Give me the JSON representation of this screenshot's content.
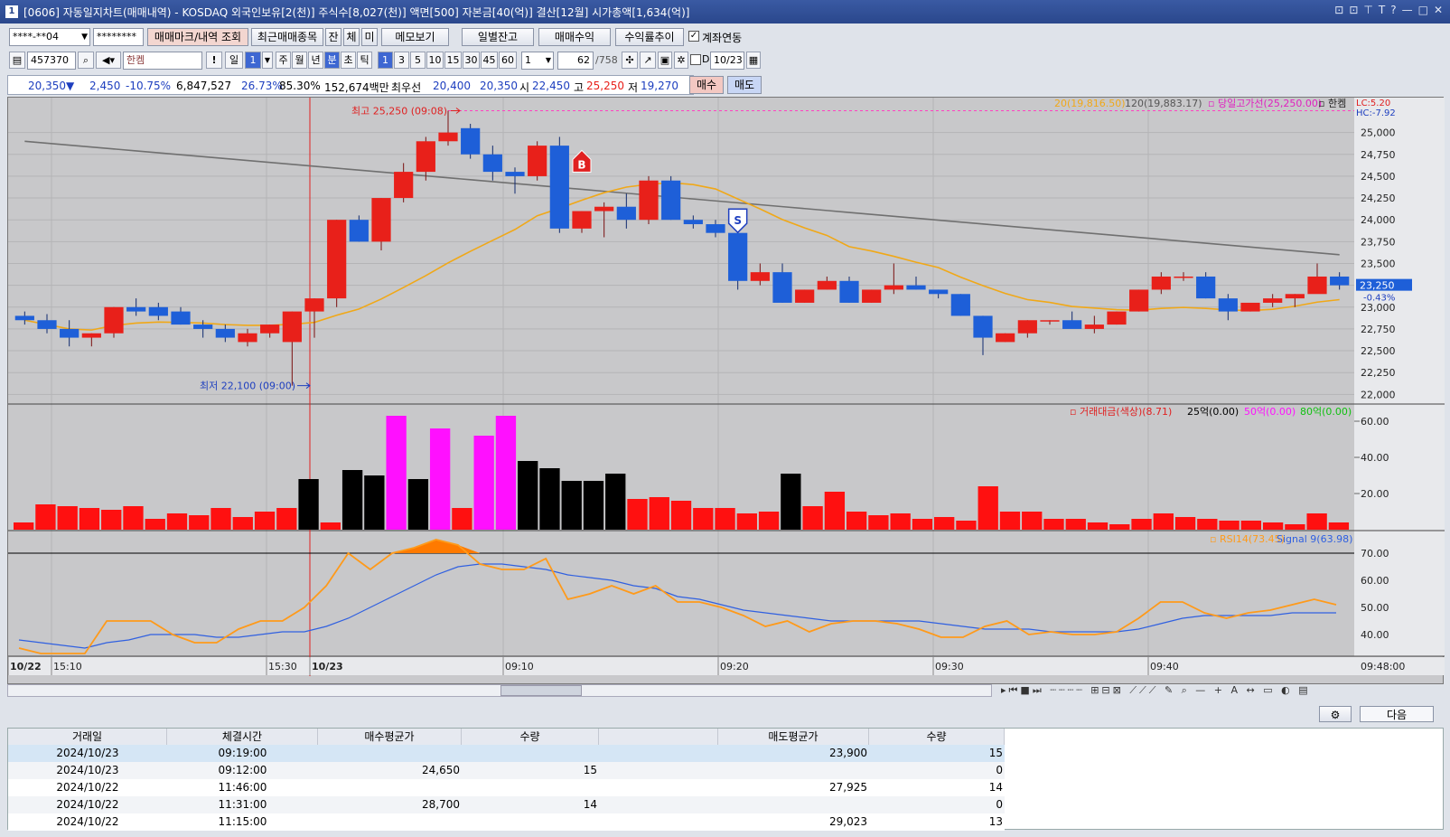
{
  "window": {
    "title": "[0606] 자동일지차트(매매내역) - KOSDAQ 외국인보유[2(천)] 주식수[8,027(천)] 액면[500] 자본금[40(억)] 결산[12월] 시가총액[1,634(억)]",
    "num": "1",
    "controls": [
      "⊡",
      "⊡",
      "⊤",
      "T",
      "?",
      "—",
      "□",
      "✕"
    ]
  },
  "toolbar1": {
    "account": "****-**04",
    "password": "********",
    "btn_mark": "매매마크/내역 조회",
    "btn_recent": "최근매매종목",
    "btn_jan": "잔",
    "btn_che": "체",
    "btn_mi": "미",
    "btn_memo": "메모보기",
    "btn_daily": "일별잔고",
    "btn_trade": "매매수익",
    "btn_rate": "수익률추이",
    "chk_link": "계좌연동"
  },
  "toolbar2": {
    "code": "457370",
    "name": "한켐",
    "periods": [
      "일",
      "1"
    ],
    "tf": [
      "주",
      "월",
      "년",
      "분",
      "초",
      "틱"
    ],
    "mins": [
      "1",
      "3",
      "5",
      "10",
      "15",
      "30",
      "45",
      "60"
    ],
    "count": "1",
    "pos": "62",
    "total": "/758",
    "date": "10/23",
    "d_label": "D"
  },
  "infobar": {
    "price": "20,350",
    "arrow": "▼",
    "change": "2,450",
    "pct": "-10.75%",
    "volume": "6,847,527",
    "r1": "26.73%",
    "r2": "85.30%",
    "amount": "152,674백만",
    "best": "최우선",
    "bid": "20,400",
    "ask": "20,350",
    "open_l": "시",
    "open": "22,450",
    "high_l": "고",
    "high": "25,250",
    "low_l": "저",
    "low": "19,270",
    "buy": "매수",
    "sell": "매도"
  },
  "price_panel": {
    "legend": {
      "ma20": "20(19,816.50)",
      "ma120": "120(19,883.17)",
      "highline": "당일고가선(25,250.00)",
      "name": "한켐",
      "lc": "LC:5.20",
      "hc": "HC:-7.92"
    },
    "yticks": [
      "25,000",
      "24,750",
      "24,500",
      "24,250",
      "24,000",
      "23,750",
      "23,500",
      "23,250",
      "23,000",
      "22,750",
      "22,500",
      "22,250",
      "22,000"
    ],
    "ymin": 21900,
    "ymax": 25400,
    "current": "23,250",
    "current_pct": "-0.43%",
    "high_label": "최고 25,250 (09:08)",
    "low_label": "최저 22,100 (09:00)",
    "marker_b": "B",
    "marker_s": "S"
  },
  "candles": [
    [
      22900,
      22950,
      22800,
      22850
    ],
    [
      22850,
      22920,
      22700,
      22750
    ],
    [
      22750,
      22850,
      22550,
      22650
    ],
    [
      22650,
      22700,
      22550,
      22700
    ],
    [
      22700,
      23000,
      22650,
      23000
    ],
    [
      23000,
      23100,
      22900,
      22950
    ],
    [
      23000,
      23050,
      22850,
      22900
    ],
    [
      22950,
      23000,
      22800,
      22800
    ],
    [
      22800,
      22850,
      22650,
      22750
    ],
    [
      22750,
      22800,
      22600,
      22650
    ],
    [
      22600,
      22750,
      22550,
      22700
    ],
    [
      22700,
      22800,
      22650,
      22800
    ],
    [
      22600,
      22950,
      22100,
      22950
    ],
    [
      22950,
      23100,
      22650,
      23100
    ],
    [
      23100,
      24000,
      23000,
      24000
    ],
    [
      24000,
      24050,
      23750,
      23750
    ],
    [
      23750,
      24250,
      23650,
      24250
    ],
    [
      24250,
      24650,
      24200,
      24550
    ],
    [
      24550,
      24950,
      24450,
      24900
    ],
    [
      24900,
      25250,
      24850,
      25000
    ],
    [
      25050,
      25100,
      24700,
      24750
    ],
    [
      24750,
      24850,
      24450,
      24550
    ],
    [
      24550,
      24600,
      24300,
      24500
    ],
    [
      24500,
      24900,
      24450,
      24850
    ],
    [
      24850,
      24950,
      23850,
      23900
    ],
    [
      23900,
      24100,
      23850,
      24100
    ],
    [
      24100,
      24200,
      23800,
      24150
    ],
    [
      24150,
      24300,
      23900,
      24000
    ],
    [
      24000,
      24500,
      23950,
      24450
    ],
    [
      24450,
      24500,
      24000,
      24000
    ],
    [
      24000,
      24050,
      23900,
      23950
    ],
    [
      23950,
      24000,
      23800,
      23850
    ],
    [
      23850,
      23900,
      23200,
      23300
    ],
    [
      23300,
      23500,
      23250,
      23400
    ],
    [
      23400,
      23500,
      23050,
      23050
    ],
    [
      23050,
      23200,
      23050,
      23200
    ],
    [
      23200,
      23350,
      23200,
      23300
    ],
    [
      23300,
      23350,
      23050,
      23050
    ],
    [
      23050,
      23200,
      23050,
      23200
    ],
    [
      23200,
      23500,
      23150,
      23250
    ],
    [
      23250,
      23350,
      23200,
      23200
    ],
    [
      23200,
      23200,
      23100,
      23150
    ],
    [
      23150,
      23150,
      22900,
      22900
    ],
    [
      22900,
      22900,
      22450,
      22650
    ],
    [
      22600,
      22700,
      22600,
      22700
    ],
    [
      22700,
      22850,
      22650,
      22850
    ],
    [
      22850,
      22850,
      22800,
      22850
    ],
    [
      22850,
      22950,
      22800,
      22750
    ],
    [
      22750,
      22900,
      22700,
      22800
    ],
    [
      22800,
      22950,
      22800,
      22950
    ],
    [
      22950,
      23200,
      22950,
      23200
    ],
    [
      23200,
      23400,
      23150,
      23350
    ],
    [
      23350,
      23400,
      23300,
      23350
    ],
    [
      23350,
      23400,
      23100,
      23100
    ],
    [
      23100,
      23150,
      22850,
      22950
    ],
    [
      22950,
      23050,
      22950,
      23050
    ],
    [
      23050,
      23150,
      23000,
      23100
    ],
    [
      23100,
      23150,
      23000,
      23150
    ],
    [
      23150,
      23500,
      23200,
      23350
    ],
    [
      23350,
      23400,
      23200,
      23250
    ]
  ],
  "volume_panel": {
    "legend_title": "거래대금(색상)(8.71)",
    "l25": "25억(0.00)",
    "l50": "50억(0.00)",
    "l80": "80억(0.00)",
    "yticks": [
      "60.00",
      "40.00",
      "20.00"
    ],
    "max": 65,
    "values": [
      4,
      14,
      13,
      12,
      11,
      13,
      6,
      9,
      8,
      12,
      7,
      10,
      12,
      28,
      4,
      33,
      30,
      63,
      28,
      56,
      12,
      52,
      63,
      38,
      34,
      27,
      27,
      31,
      17,
      18,
      16,
      12,
      12,
      9,
      10,
      31,
      13,
      21,
      10,
      8,
      9,
      6,
      7,
      5,
      24,
      10,
      10,
      6,
      6,
      4,
      3,
      6,
      9,
      7,
      6,
      5,
      5,
      4,
      3,
      9,
      4
    ],
    "colors": [
      "r",
      "r",
      "r",
      "r",
      "r",
      "r",
      "r",
      "r",
      "r",
      "r",
      "r",
      "r",
      "r",
      "k",
      "r",
      "k",
      "k",
      "m",
      "k",
      "m",
      "r",
      "m",
      "m",
      "k",
      "k",
      "k",
      "k",
      "k",
      "r",
      "r",
      "r",
      "r",
      "r",
      "r",
      "r",
      "k",
      "r",
      "r",
      "r",
      "r",
      "r",
      "r",
      "r",
      "r",
      "r",
      "r",
      "r",
      "r",
      "r",
      "r",
      "r",
      "r",
      "r",
      "r",
      "r",
      "r",
      "r",
      "r",
      "r",
      "r",
      "r"
    ]
  },
  "rsi_panel": {
    "legend_rsi": "RSI14(73.45)",
    "legend_sig": "Signal 9(63.98)",
    "yticks": [
      "70.00",
      "60.00",
      "50.00",
      "40.00"
    ],
    "min": 32,
    "max": 78,
    "rsi": [
      35,
      33,
      33,
      33,
      45,
      45,
      45,
      40,
      37,
      37,
      42,
      45,
      45,
      50,
      58,
      70,
      64,
      70,
      72,
      75,
      73,
      66,
      64,
      64,
      68,
      53,
      55,
      58,
      55,
      58,
      52,
      52,
      50,
      47,
      43,
      45,
      41,
      44,
      45,
      45,
      44,
      42,
      39,
      39,
      43,
      45,
      40,
      41,
      40,
      40,
      41,
      46,
      52,
      52,
      48,
      46,
      48,
      49,
      51,
      53,
      51
    ],
    "sig": [
      38,
      37,
      36,
      35,
      37,
      38,
      40,
      40,
      40,
      39,
      39,
      40,
      41,
      41,
      43,
      46,
      50,
      54,
      58,
      62,
      65,
      66,
      66,
      65,
      64,
      62,
      61,
      60,
      58,
      57,
      54,
      53,
      51,
      49,
      48,
      47,
      46,
      45,
      45,
      45,
      45,
      45,
      44,
      43,
      42,
      42,
      42,
      41,
      41,
      41,
      41,
      42,
      44,
      46,
      47,
      47,
      47,
      47,
      48,
      48,
      48
    ]
  },
  "xaxis": {
    "labels": [
      {
        "t": "10/22",
        "b": true
      },
      {
        "t": "15:10"
      },
      {
        "t": "15:30"
      },
      {
        "t": "10/23",
        "b": true
      },
      {
        "t": "09:10"
      },
      {
        "t": "09:20"
      },
      {
        "t": "09:30"
      },
      {
        "t": "09:40"
      }
    ],
    "end": "09:48:00"
  },
  "bottom": {
    "next": "다음"
  },
  "trades": {
    "headers": [
      "거래일",
      "체결시간",
      "매수평균가",
      "수량",
      "",
      "매도평균가",
      "수량"
    ],
    "rows": [
      [
        "2024/10/23",
        "09:19:00",
        "",
        "",
        "",
        "23,900",
        "15"
      ],
      [
        "2024/10/23",
        "09:12:00",
        "24,650",
        "15",
        "",
        "",
        "0"
      ],
      [
        "2024/10/22",
        "11:46:00",
        "",
        "",
        "",
        "27,925",
        "14"
      ],
      [
        "2024/10/22",
        "11:31:00",
        "28,700",
        "14",
        "",
        "",
        "0"
      ],
      [
        "2024/10/22",
        "11:15:00",
        "",
        "",
        "",
        "29,023",
        "13"
      ]
    ]
  },
  "colors": {
    "up": "#e8201a",
    "down": "#1e5fd8",
    "black": "#000000",
    "magenta": "#ff00ff",
    "ma20": "#f0a818",
    "ma120": "#707070",
    "rsi": "#ff9a1a",
    "signal": "#3060e0",
    "title_bg": "#2a478c"
  }
}
